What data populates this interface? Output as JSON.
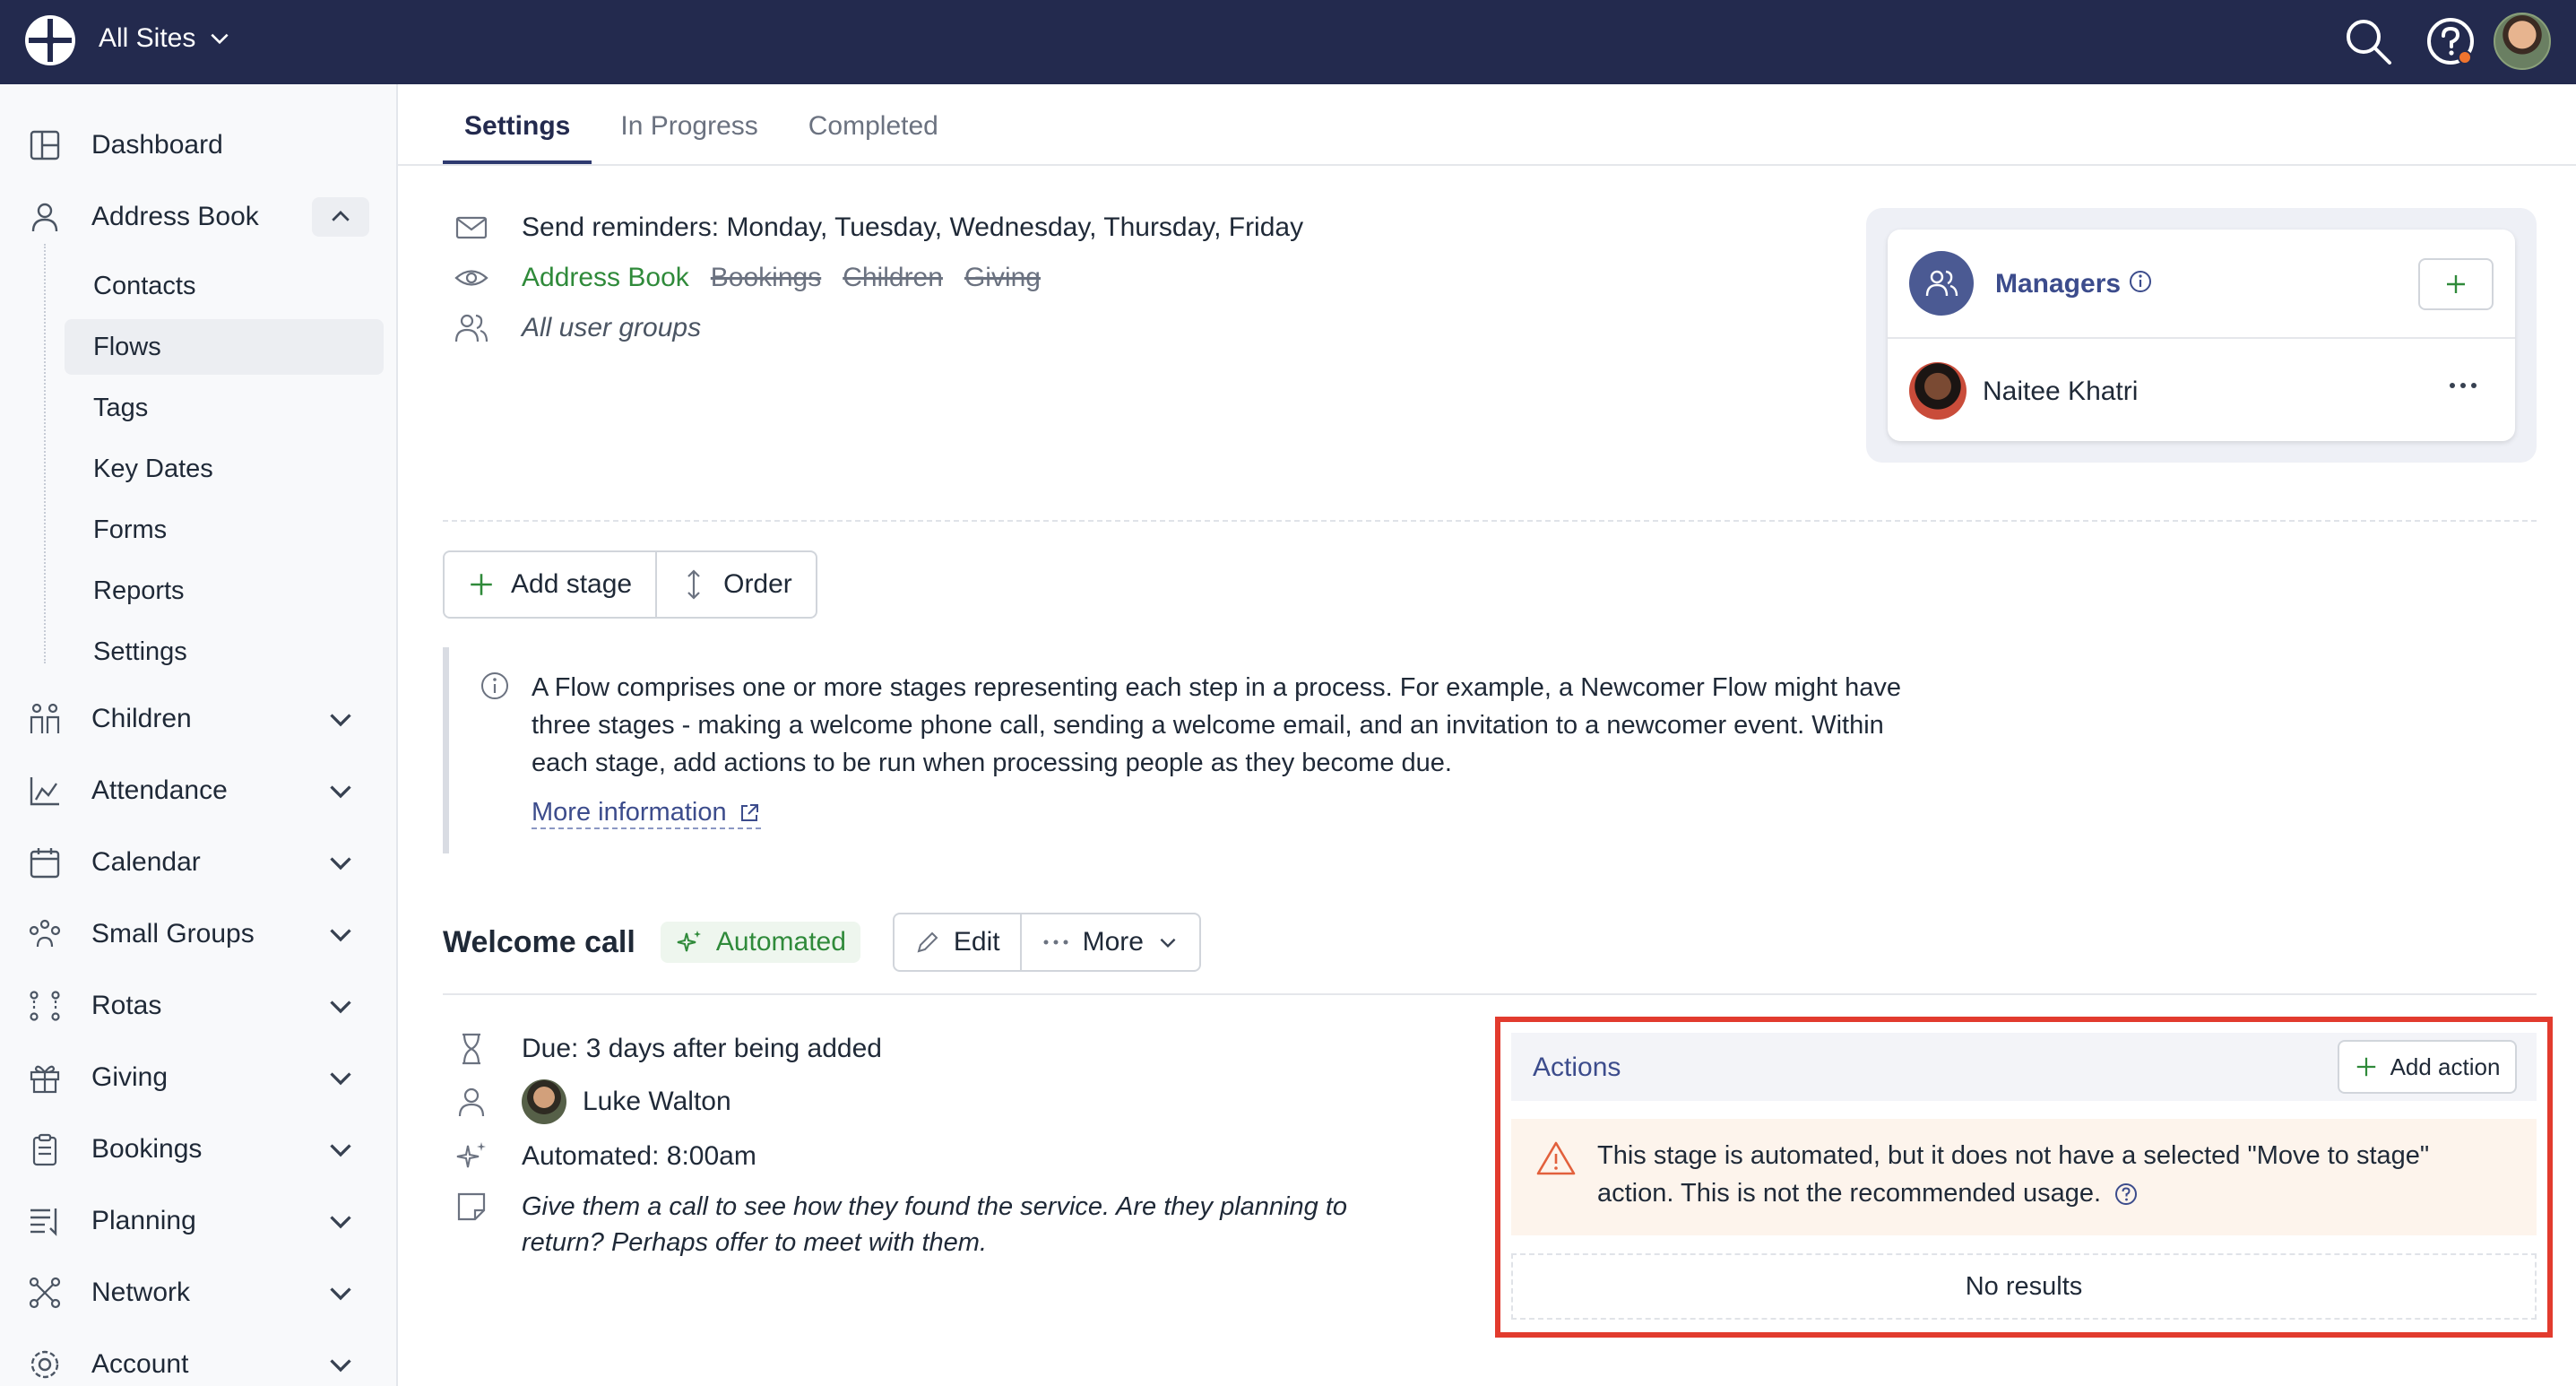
{
  "topbar": {
    "site_selector": "All Sites"
  },
  "sidebar": {
    "items": [
      {
        "label": "Dashboard",
        "icon": "dashboard-icon"
      },
      {
        "label": "Address Book",
        "icon": "person-icon",
        "expanded": true
      },
      {
        "label": "Children",
        "icon": "children-icon"
      },
      {
        "label": "Attendance",
        "icon": "chart-icon"
      },
      {
        "label": "Calendar",
        "icon": "calendar-icon"
      },
      {
        "label": "Small Groups",
        "icon": "groups-icon"
      },
      {
        "label": "Rotas",
        "icon": "rotas-icon"
      },
      {
        "label": "Giving",
        "icon": "gift-icon"
      },
      {
        "label": "Bookings",
        "icon": "clipboard-icon"
      },
      {
        "label": "Planning",
        "icon": "planning-icon"
      },
      {
        "label": "Network",
        "icon": "network-icon"
      },
      {
        "label": "Account",
        "icon": "gear-icon"
      }
    ],
    "address_book_sub": [
      "Contacts",
      "Flows",
      "Tags",
      "Key Dates",
      "Forms",
      "Reports",
      "Settings"
    ],
    "active_sub": "Flows"
  },
  "tabs": [
    "Settings",
    "In Progress",
    "Completed"
  ],
  "active_tab": "Settings",
  "flow_settings": {
    "reminders": "Send reminders: Monday, Tuesday, Wednesday, Thursday, Friday",
    "visibility_active": "Address Book",
    "visibility_disabled": [
      "Bookings",
      "Children",
      "Giving"
    ],
    "user_groups": "All user groups"
  },
  "managers": {
    "title": "Managers",
    "people": [
      {
        "name": "Naitee Khatri"
      }
    ]
  },
  "toolbar": {
    "add_stage": "Add stage",
    "order": "Order"
  },
  "info": {
    "text": "A Flow comprises one or more stages representing each step in a process. For example, a Newcomer Flow might have three stages - making a welcome phone call, sending a welcome email, and an invitation to a newcomer event. Within each stage, add actions to be run when processing people as they become due.",
    "link": "More information"
  },
  "stage": {
    "title": "Welcome call",
    "badge": "Automated",
    "edit": "Edit",
    "more": "More",
    "due": "Due: 3 days after being added",
    "assignee": "Luke Walton",
    "automated_time": "Automated: 8:00am",
    "note": "Give them a call to see how they found the service. Are they planning to return? Perhaps offer to meet with them."
  },
  "actions": {
    "title": "Actions",
    "add_label": "Add action",
    "warning": "This stage is automated, but it does not have a selected \"Move to stage\" action. This is not the recommended usage.",
    "empty": "No results"
  },
  "colors": {
    "topbar": "#232a4e",
    "accent": "#3c4c8c",
    "green": "#2f8a3a",
    "highlight": "#e23b2e",
    "warning": "#e2603c"
  }
}
